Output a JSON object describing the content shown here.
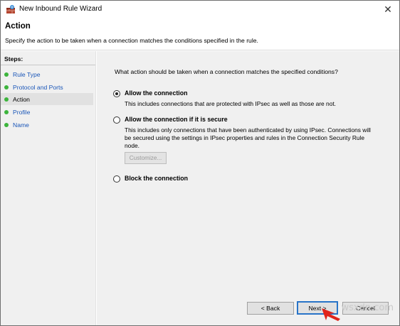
{
  "window": {
    "title": "New Inbound Rule Wizard",
    "close_glyph": "✕"
  },
  "header": {
    "title": "Action",
    "description": "Specify the action to be taken when a connection matches the conditions specified in the rule."
  },
  "steps": {
    "heading": "Steps:",
    "items": [
      {
        "label": "Rule Type",
        "active": false
      },
      {
        "label": "Protocol and Ports",
        "active": false
      },
      {
        "label": "Action",
        "active": true
      },
      {
        "label": "Profile",
        "active": false
      },
      {
        "label": "Name",
        "active": false
      }
    ]
  },
  "content": {
    "question": "What action should be taken when a connection matches the specified conditions?",
    "options": [
      {
        "label": "Allow the connection",
        "selected": true,
        "description": "This includes connections that are protected with IPsec as well as those are not."
      },
      {
        "label": "Allow the connection if it is secure",
        "selected": false,
        "description": "This includes only connections that have been authenticated by using IPsec.  Connections will be secured using the settings in IPsec properties and rules in the Connection Security Rule node."
      },
      {
        "label": "Block the connection",
        "selected": false,
        "description": ""
      }
    ],
    "customize_label": "Customize..."
  },
  "buttons": {
    "back": "< Back",
    "next": "Next >",
    "cancel": "Cancel"
  },
  "watermark": "wsxdn.com",
  "colors": {
    "step_bullet": "#3cb43c",
    "link_blue": "#1a56b8",
    "arrow_red": "#e0241b",
    "default_button_border": "#2874c8"
  }
}
